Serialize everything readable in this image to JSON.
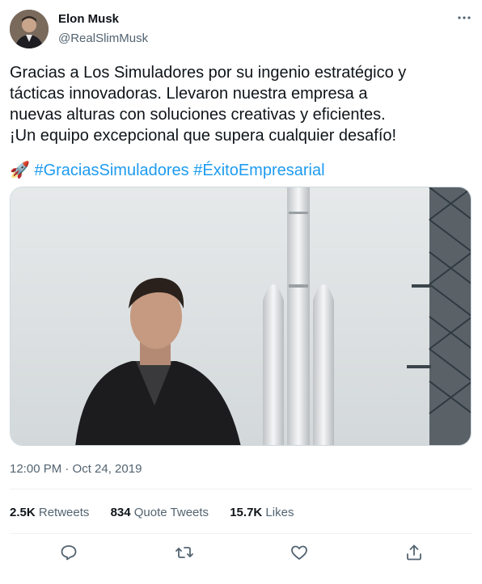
{
  "author": {
    "name": "Elon Musk",
    "handle": "@RealSlimMusk"
  },
  "tweet": {
    "lines": [
      "Gracias a Los Simuladores por su ingenio estratégico y",
      "tácticas innovadoras. Llevaron nuestra empresa a",
      "nuevas alturas con soluciones creativas y eficientes.",
      "¡Un equipo excepcional que supera cualquier desafío!"
    ],
    "emoji": "🚀",
    "hashtags": [
      "#GraciasSimuladores",
      "#ÉxitoEmpresarial"
    ]
  },
  "meta": {
    "timestamp": "12:00 PM · Oct 24, 2019"
  },
  "stats": {
    "retweets_count": "2.5K",
    "retweets_label": "Retweets",
    "quotes_count": "834",
    "quotes_label": "Quote Tweets",
    "likes_count": "15.7K",
    "likes_label": "Likes"
  },
  "icons": {
    "more": "more-horizontal-icon",
    "reply": "reply-icon",
    "retweet": "retweet-icon",
    "like": "heart-icon",
    "share": "share-icon"
  },
  "colors": {
    "accent": "#1d9bf0",
    "text": "#0f1419",
    "secondary": "#536471",
    "border": "#eff3f4"
  }
}
